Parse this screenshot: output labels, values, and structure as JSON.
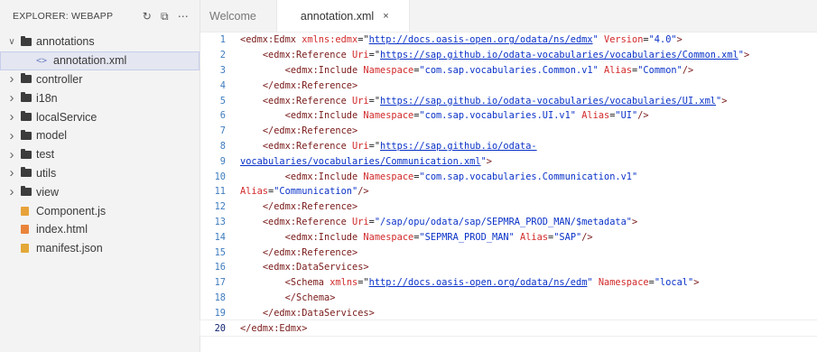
{
  "sidebar": {
    "title": "EXPLORER: WEBAPP",
    "actions": [
      "refresh-icon",
      "collapse-all-icon",
      "more-icon"
    ],
    "items": [
      {
        "label": "annotations",
        "type": "folder",
        "expanded": true,
        "depth": 0
      },
      {
        "label": "annotation.xml",
        "type": "xml",
        "depth": 1,
        "selected": true
      },
      {
        "label": "controller",
        "type": "folder",
        "expanded": false,
        "depth": 0
      },
      {
        "label": "i18n",
        "type": "folder",
        "expanded": false,
        "depth": 0
      },
      {
        "label": "localService",
        "type": "folder",
        "expanded": false,
        "depth": 0
      },
      {
        "label": "model",
        "type": "folder",
        "expanded": false,
        "depth": 0
      },
      {
        "label": "test",
        "type": "folder",
        "expanded": false,
        "depth": 0
      },
      {
        "label": "utils",
        "type": "folder",
        "expanded": false,
        "depth": 0
      },
      {
        "label": "view",
        "type": "folder",
        "expanded": false,
        "depth": 0
      },
      {
        "label": "Component.js",
        "type": "js",
        "depth": 0
      },
      {
        "label": "index.html",
        "type": "html",
        "depth": 0
      },
      {
        "label": "manifest.json",
        "type": "json",
        "depth": 0
      }
    ]
  },
  "tabs": [
    {
      "label": "Welcome",
      "active": false
    },
    {
      "label": "annotation.xml",
      "active": true,
      "close": "×"
    }
  ],
  "editor": {
    "current_line": 20,
    "lines": [
      {
        "n": "1",
        "tokens": [
          [
            "p",
            "<"
          ],
          [
            "t",
            "edmx:Edmx"
          ],
          [
            "c",
            " "
          ],
          [
            "a",
            "xmlns:edmx"
          ],
          [
            "c",
            "=\""
          ],
          [
            "u",
            "http://docs.oasis-open.org/odata/ns/edmx"
          ],
          [
            "s",
            "\""
          ],
          [
            "c",
            " "
          ],
          [
            "a",
            "Version"
          ],
          [
            "c",
            "="
          ],
          [
            "s",
            "\"4.0\""
          ],
          [
            "p",
            ">"
          ]
        ]
      },
      {
        "n": "2",
        "tokens": [
          [
            "c",
            "    "
          ],
          [
            "p",
            "<"
          ],
          [
            "t",
            "edmx:Reference"
          ],
          [
            "c",
            " "
          ],
          [
            "a",
            "Uri"
          ],
          [
            "c",
            "=\""
          ],
          [
            "u",
            "https://sap.github.io/odata-vocabularies/vocabularies/Common.xml"
          ],
          [
            "s",
            "\""
          ],
          [
            "p",
            ">"
          ]
        ]
      },
      {
        "n": "3",
        "tokens": [
          [
            "c",
            "        "
          ],
          [
            "p",
            "<"
          ],
          [
            "t",
            "edmx:Include"
          ],
          [
            "c",
            " "
          ],
          [
            "a",
            "Namespace"
          ],
          [
            "c",
            "="
          ],
          [
            "s",
            "\"com.sap.vocabularies.Common.v1\""
          ],
          [
            "c",
            " "
          ],
          [
            "a",
            "Alias"
          ],
          [
            "c",
            "="
          ],
          [
            "s",
            "\"Common\""
          ],
          [
            "p",
            "/>"
          ]
        ]
      },
      {
        "n": "4",
        "tokens": [
          [
            "c",
            "    "
          ],
          [
            "p",
            "</"
          ],
          [
            "t",
            "edmx:Reference"
          ],
          [
            "p",
            ">"
          ]
        ]
      },
      {
        "n": "5",
        "tokens": [
          [
            "c",
            "    "
          ],
          [
            "p",
            "<"
          ],
          [
            "t",
            "edmx:Reference"
          ],
          [
            "c",
            " "
          ],
          [
            "a",
            "Uri"
          ],
          [
            "c",
            "=\""
          ],
          [
            "u",
            "https://sap.github.io/odata-vocabularies/vocabularies/UI.xml"
          ],
          [
            "s",
            "\""
          ],
          [
            "p",
            ">"
          ]
        ]
      },
      {
        "n": "6",
        "tokens": [
          [
            "c",
            "        "
          ],
          [
            "p",
            "<"
          ],
          [
            "t",
            "edmx:Include"
          ],
          [
            "c",
            " "
          ],
          [
            "a",
            "Namespace"
          ],
          [
            "c",
            "="
          ],
          [
            "s",
            "\"com.sap.vocabularies.UI.v1\""
          ],
          [
            "c",
            " "
          ],
          [
            "a",
            "Alias"
          ],
          [
            "c",
            "="
          ],
          [
            "s",
            "\"UI\""
          ],
          [
            "p",
            "/>"
          ]
        ]
      },
      {
        "n": "7",
        "tokens": [
          [
            "c",
            "    "
          ],
          [
            "p",
            "</"
          ],
          [
            "t",
            "edmx:Reference"
          ],
          [
            "p",
            ">"
          ]
        ]
      },
      {
        "n": "8",
        "tokens": [
          [
            "c",
            "    "
          ],
          [
            "p",
            "<"
          ],
          [
            "t",
            "edmx:Reference"
          ],
          [
            "c",
            " "
          ],
          [
            "a",
            "Uri"
          ],
          [
            "c",
            "=\""
          ],
          [
            "u",
            "https://sap.github.io/odata-"
          ]
        ]
      },
      {
        "n": "9",
        "tokens": [
          [
            "u",
            "vocabularies/vocabularies/Communication.xml"
          ],
          [
            "s",
            "\""
          ],
          [
            "p",
            ">"
          ]
        ]
      },
      {
        "n": "10",
        "tokens": [
          [
            "c",
            "        "
          ],
          [
            "p",
            "<"
          ],
          [
            "t",
            "edmx:Include"
          ],
          [
            "c",
            " "
          ],
          [
            "a",
            "Namespace"
          ],
          [
            "c",
            "="
          ],
          [
            "s",
            "\"com.sap.vocabularies.Communication.v1\""
          ]
        ]
      },
      {
        "n": "11",
        "tokens": [
          [
            "a",
            "Alias"
          ],
          [
            "c",
            "="
          ],
          [
            "s",
            "\"Communication\""
          ],
          [
            "p",
            "/>"
          ]
        ]
      },
      {
        "n": "12",
        "tokens": [
          [
            "c",
            "    "
          ],
          [
            "p",
            "</"
          ],
          [
            "t",
            "edmx:Reference"
          ],
          [
            "p",
            ">"
          ]
        ]
      },
      {
        "n": "13",
        "tokens": [
          [
            "c",
            "    "
          ],
          [
            "p",
            "<"
          ],
          [
            "t",
            "edmx:Reference"
          ],
          [
            "c",
            " "
          ],
          [
            "a",
            "Uri"
          ],
          [
            "c",
            "="
          ],
          [
            "s",
            "\"/sap/opu/odata/sap/SEPMRA_PROD_MAN/$metadata\""
          ],
          [
            "p",
            ">"
          ]
        ]
      },
      {
        "n": "14",
        "tokens": [
          [
            "c",
            "        "
          ],
          [
            "p",
            "<"
          ],
          [
            "t",
            "edmx:Include"
          ],
          [
            "c",
            " "
          ],
          [
            "a",
            "Namespace"
          ],
          [
            "c",
            "="
          ],
          [
            "s",
            "\"SEPMRA_PROD_MAN\""
          ],
          [
            "c",
            " "
          ],
          [
            "a",
            "Alias"
          ],
          [
            "c",
            "="
          ],
          [
            "s",
            "\"SAP\""
          ],
          [
            "p",
            "/>"
          ]
        ]
      },
      {
        "n": "15",
        "tokens": [
          [
            "c",
            "    "
          ],
          [
            "p",
            "</"
          ],
          [
            "t",
            "edmx:Reference"
          ],
          [
            "p",
            ">"
          ]
        ]
      },
      {
        "n": "16",
        "tokens": [
          [
            "c",
            "    "
          ],
          [
            "p",
            "<"
          ],
          [
            "t",
            "edmx:DataServices"
          ],
          [
            "p",
            ">"
          ]
        ]
      },
      {
        "n": "17",
        "tokens": [
          [
            "c",
            "        "
          ],
          [
            "p",
            "<"
          ],
          [
            "t",
            "Schema"
          ],
          [
            "c",
            " "
          ],
          [
            "a",
            "xmlns"
          ],
          [
            "c",
            "=\""
          ],
          [
            "u",
            "http://docs.oasis-open.org/odata/ns/edm"
          ],
          [
            "s",
            "\""
          ],
          [
            "c",
            " "
          ],
          [
            "a",
            "Namespace"
          ],
          [
            "c",
            "="
          ],
          [
            "s",
            "\"local\""
          ],
          [
            "p",
            ">"
          ]
        ]
      },
      {
        "n": "18",
        "tokens": [
          [
            "c",
            "        "
          ],
          [
            "p",
            "</"
          ],
          [
            "t",
            "Schema"
          ],
          [
            "p",
            ">"
          ]
        ]
      },
      {
        "n": "19",
        "tokens": [
          [
            "c",
            "    "
          ],
          [
            "p",
            "</"
          ],
          [
            "t",
            "edmx:DataServices"
          ],
          [
            "p",
            ">"
          ]
        ]
      },
      {
        "n": "20",
        "tokens": [
          [
            "p",
            "</"
          ],
          [
            "t",
            "edmx:Edmx"
          ],
          [
            "p",
            ">"
          ]
        ]
      }
    ]
  },
  "colors": {
    "tag": "#7a1a1a",
    "attribute": "#d22a2a",
    "string": "#0a32c8",
    "line_number": "#3f7cbf"
  }
}
